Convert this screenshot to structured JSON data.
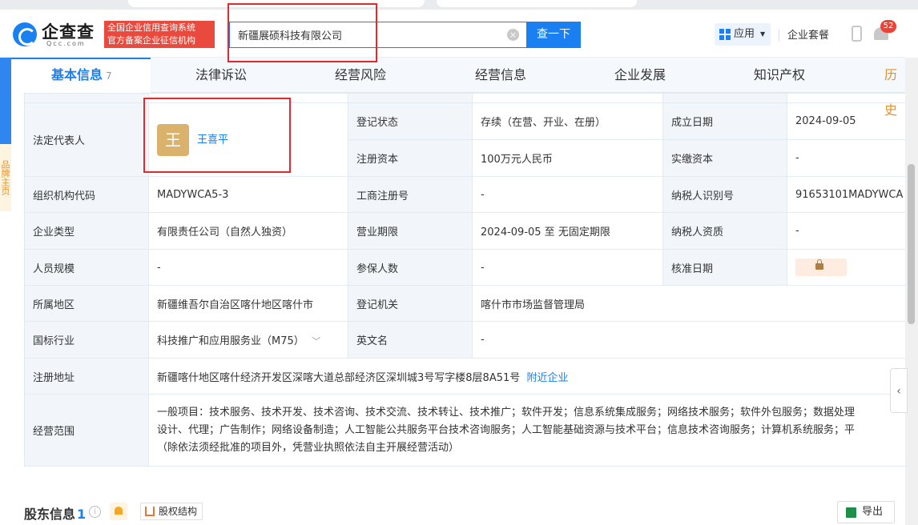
{
  "header": {
    "brand": "企查查",
    "brand_sub": "Qcc.com",
    "tag_line1": "全国企业信用查询系统",
    "tag_line2": "官方备案企业征信机构",
    "search_value": "新疆展硕科技有限公司",
    "search_button": "查一下",
    "app_button": "应用",
    "suite_label": "企业套餐",
    "notify_count": "52"
  },
  "tabs": [
    {
      "label": "基本信息",
      "count": "7"
    },
    {
      "label": "法律诉讼"
    },
    {
      "label": "经营风险"
    },
    {
      "label": "经营信息"
    },
    {
      "label": "企业发展"
    },
    {
      "label": "知识产权"
    },
    {
      "label": "历史"
    }
  ],
  "side_promo": "品牌主页",
  "info": {
    "legal_rep_label": "法定代表人",
    "legal_rep_initial": "王",
    "legal_rep_name": "王喜平",
    "reg_status_label": "登记状态",
    "reg_status_value": "存续（在营、开业、在册）",
    "est_date_label": "成立日期",
    "est_date_value": "2024-09-05",
    "reg_capital_label": "注册资本",
    "reg_capital_value": "100万元人民币",
    "paid_capital_label": "实缴资本",
    "paid_capital_value": "-",
    "org_code_label": "组织机构代码",
    "org_code_value": "MADYWCA5-3",
    "biz_reg_no_label": "工商注册号",
    "biz_reg_no_value": "-",
    "taxpayer_id_label": "纳税人识别号",
    "taxpayer_id_value": "91653101MADYWCA",
    "company_type_label": "企业类型",
    "company_type_value": "有限责任公司（自然人独资）",
    "biz_term_label": "营业期限",
    "biz_term_value": "2024-09-05 至 无固定期限",
    "taxpayer_qual_label": "纳税人资质",
    "taxpayer_qual_value": "-",
    "staff_size_label": "人员规模",
    "staff_size_value": "-",
    "insured_label": "参保人数",
    "insured_value": "-",
    "approval_date_label": "核准日期",
    "region_label": "所属地区",
    "region_value": "新疆维吾尔自治区喀什地区喀什市",
    "reg_authority_label": "登记机关",
    "reg_authority_value": "喀什市市场监督管理局",
    "industry_label": "国标行业",
    "industry_value": "科技推广和应用服务业（M75）",
    "english_name_label": "英文名",
    "english_name_value": "-",
    "address_label": "注册地址",
    "address_value": "新疆喀什地区喀什经济开发区深喀大道总部经济区深圳城3号写字楼8层8A51号",
    "nearby_link": "附近企业",
    "scope_label": "经营范围",
    "scope_line1": "一般项目：技术服务、技术开发、技术咨询、技术交流、技术转让、技术推广；软件开发；信息系统集成服务；网络技术服务；软件外包服务；数据处理",
    "scope_line2": "设计、代理；广告制作；网络设备制造；人工智能公共服务平台技术咨询服务；人工智能基础资源与技术平台；信息技术咨询服务；计算机系统服务；平",
    "scope_line3": "（除依法须经批准的项目外，凭营业执照依法自主开展经营活动）"
  },
  "shareholders": {
    "title": "股东信息",
    "count": "1",
    "equity_button": "股权结构",
    "export_button": "导出"
  },
  "colors": {
    "accent": "#1a7ff0",
    "annotation_red": "#e8272a",
    "avatar_gold": "#dab26b"
  }
}
